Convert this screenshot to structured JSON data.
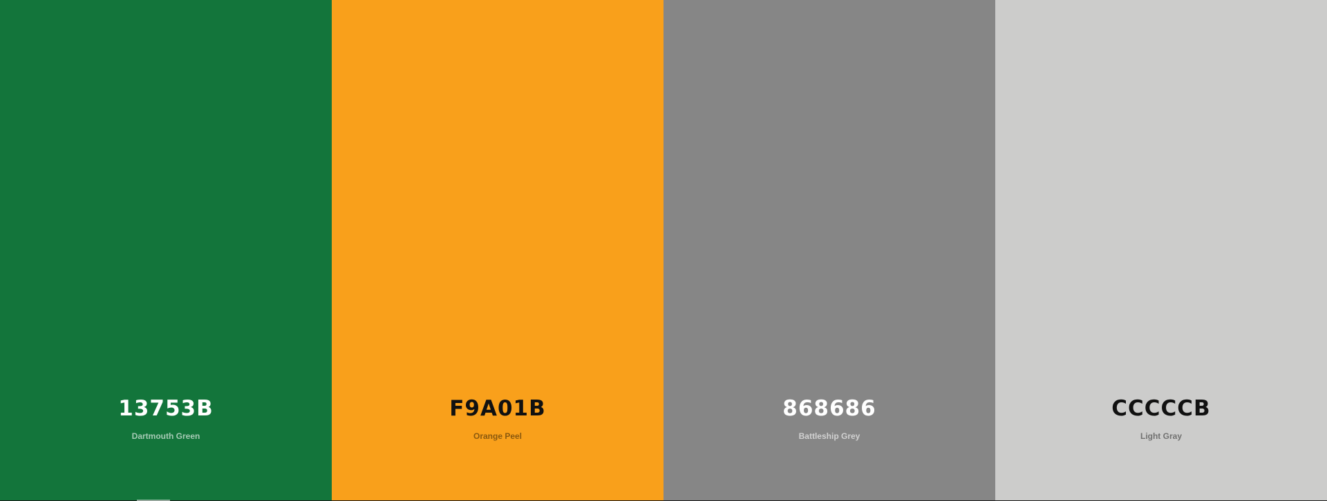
{
  "palette": {
    "swatches": [
      {
        "hex": "13753B",
        "name": "Dartmouth Green",
        "color": "#13753B"
      },
      {
        "hex": "F9A01B",
        "name": "Orange Peel",
        "color": "#F9A01B"
      },
      {
        "hex": "868686",
        "name": "Battleship Grey",
        "color": "#868686"
      },
      {
        "hex": "CCCCCB",
        "name": "Light Gray",
        "color": "#CCCCCB"
      }
    ]
  }
}
